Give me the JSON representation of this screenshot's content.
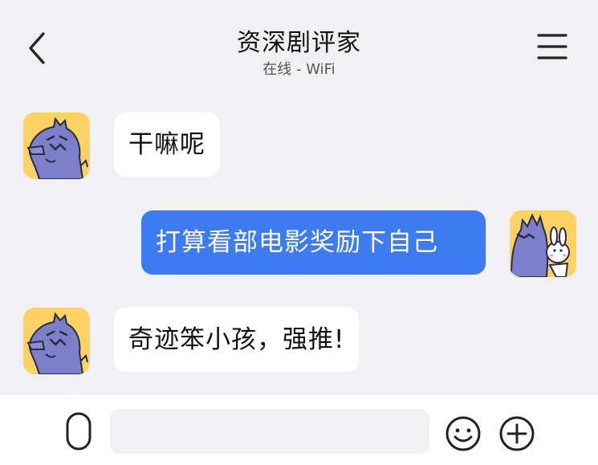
{
  "header": {
    "title": "资深剧评家",
    "status": "在线 - WiFi",
    "back_icon": "chevron-left-icon",
    "menu_icon": "hamburger-menu-icon"
  },
  "messages": [
    {
      "direction": "incoming",
      "text": "干嘛呢",
      "avatar": "purple-dinosaur-avatar"
    },
    {
      "direction": "outgoing",
      "text": "打算看部电影奖励下自己",
      "avatar": "purple-dinosaur-with-bunny-avatar"
    },
    {
      "direction": "incoming",
      "text": "奇迹笨小孩，强推!",
      "avatar": "purple-dinosaur-avatar"
    }
  ],
  "composer": {
    "input_value": "",
    "voice_icon": "microphone-icon",
    "emoji_icon": "smiley-icon",
    "plus_icon": "plus-circle-icon"
  },
  "colors": {
    "background": "#f1f1f4",
    "outgoing_bubble": "#3d7bf2",
    "incoming_bubble": "#ffffff",
    "avatar_bg": "#ffd266",
    "dino": "#7b80c8"
  }
}
